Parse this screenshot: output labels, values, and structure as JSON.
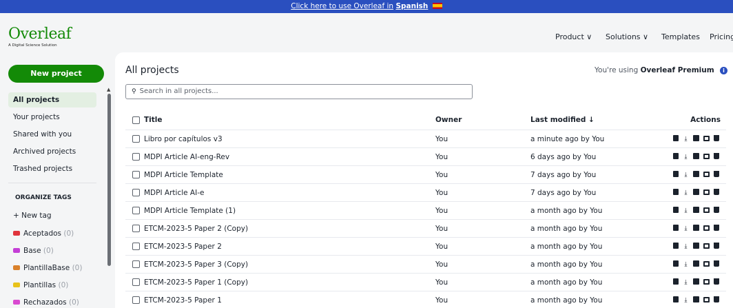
{
  "banner": {
    "text": "Click here to use Overleaf in",
    "language": "Spanish"
  },
  "logo": {
    "name": "Overleaf",
    "tagline": "A Digital Science Solution"
  },
  "nav": [
    {
      "label": "Product ∨"
    },
    {
      "label": "Solutions ∨"
    },
    {
      "label": "Templates"
    },
    {
      "label": "Pricing"
    }
  ],
  "sidebar": {
    "new_project": "New project",
    "items": [
      {
        "label": "All projects",
        "active": true
      },
      {
        "label": "Your projects"
      },
      {
        "label": "Shared with you"
      },
      {
        "label": "Archived projects"
      },
      {
        "label": "Trashed projects"
      }
    ],
    "tags_heading": "ORGANIZE TAGS",
    "new_tag": "+ New tag",
    "tags": [
      {
        "name": "Aceptados",
        "count": "(0)",
        "color": "#e0343c"
      },
      {
        "name": "Base",
        "count": "(0)",
        "color": "#c43fd6"
      },
      {
        "name": "PlantillaBase",
        "count": "(0)",
        "color": "#d9812b"
      },
      {
        "name": "Plantillas",
        "count": "(0)",
        "color": "#e8c21a"
      },
      {
        "name": "Rechazados",
        "count": "(0)",
        "color": "#d94ad1"
      }
    ]
  },
  "main": {
    "title": "All projects",
    "premium_prefix": "You're using",
    "premium_name": "Overleaf Premium",
    "search_placeholder": "Search in all projects...",
    "columns": {
      "title": "Title",
      "owner": "Owner",
      "modified": "Last modified ↓",
      "actions": "Actions"
    },
    "projects": [
      {
        "title": "Libro por capítulos v3",
        "owner": "You",
        "modified": "a minute ago by You"
      },
      {
        "title": "MDPI Article AI-eng-Rev",
        "owner": "You",
        "modified": "6 days ago by You"
      },
      {
        "title": "MDPI Article Template",
        "owner": "You",
        "modified": "7 days ago by You"
      },
      {
        "title": "MDPI Article AI-e",
        "owner": "You",
        "modified": "7 days ago by You"
      },
      {
        "title": "MDPI Article Template (1)",
        "owner": "You",
        "modified": "a month ago by You"
      },
      {
        "title": "ETCM-2023-5 Paper 2 (Copy)",
        "owner": "You",
        "modified": "a month ago by You"
      },
      {
        "title": "ETCM-2023-5 Paper 2",
        "owner": "You",
        "modified": "a month ago by You"
      },
      {
        "title": "ETCM-2023-5 Paper 3 (Copy)",
        "owner": "You",
        "modified": "a month ago by You"
      },
      {
        "title": "ETCM-2023-5 Paper 1 (Copy)",
        "owner": "You",
        "modified": "a month ago by You"
      },
      {
        "title": "ETCM-2023-5 Paper 1",
        "owner": "You",
        "modified": "a month ago by You"
      }
    ]
  },
  "icons": {
    "search": "search-icon",
    "info": "info-icon",
    "copy": "copy-icon",
    "download": "download-icon",
    "pdf": "download-pdf-icon",
    "git": "archive-icon",
    "trash": "trash-icon"
  },
  "colors": {
    "brand_green": "#138a07",
    "banner_blue": "#2a4fbf",
    "active_bg": "#e3efe2"
  }
}
